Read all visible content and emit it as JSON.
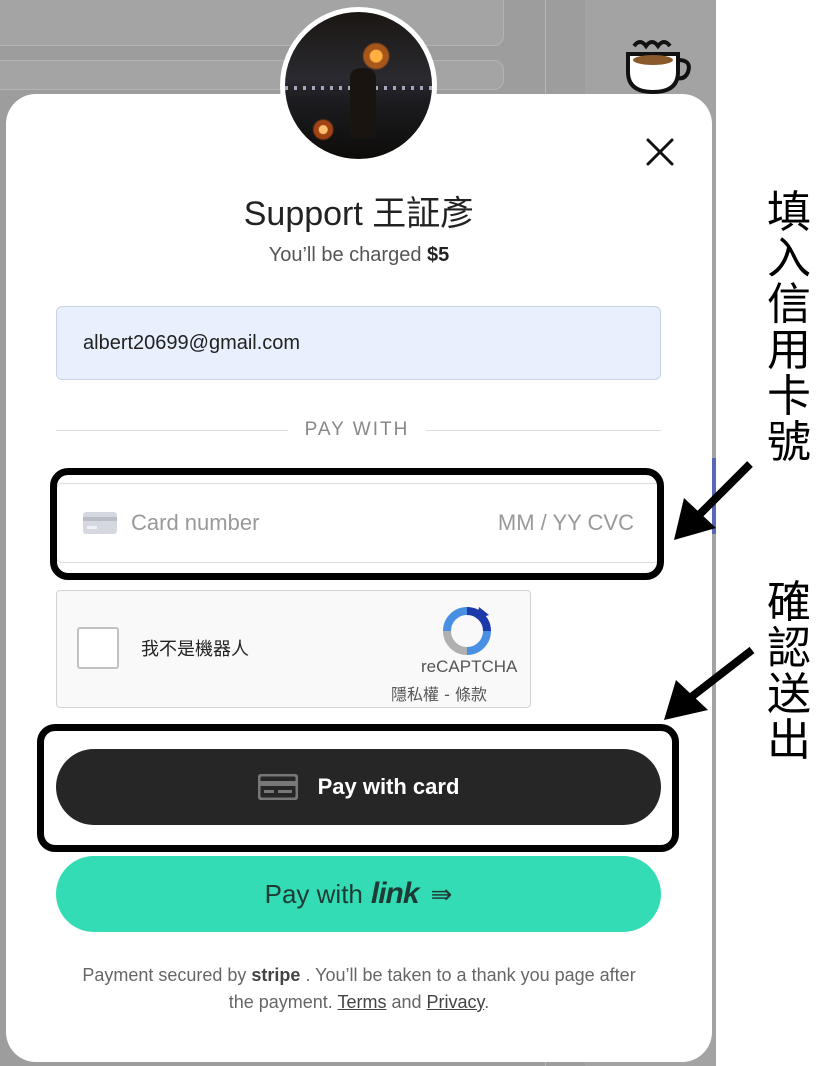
{
  "modal": {
    "title": "Support 王証彥",
    "charge_prefix": "You’ll be charged ",
    "charge_amount": "$5",
    "email": "albert20699@gmail.com",
    "pay_with_label": "PAY WITH",
    "card_placeholder": "Card number",
    "card_expiry_cvc": "MM / YY CVC",
    "captcha": {
      "label": "我不是機器人",
      "brand": "reCAPTCHA",
      "terms": "隱私權 - 條款"
    },
    "pay_card_label": "Pay with card",
    "pay_link_prefix": "Pay with",
    "pay_link_brand": "link",
    "pay_link_arrow": "⇛",
    "footer": {
      "part1": "Payment secured by ",
      "stripe": "stripe",
      "part2": " . You’ll be taken to a thank you page after the payment. ",
      "terms": "Terms",
      "and": " and ",
      "privacy": "Privacy",
      "end": "."
    }
  },
  "annotations": {
    "card_note": "填入信用卡號",
    "submit_note": "確認送出"
  },
  "colors": {
    "link_green": "#33dcb4",
    "dark_button": "#262626",
    "email_bg": "#e8f0fe"
  },
  "icons": [
    "close-icon",
    "card-icon",
    "recaptcha-icon",
    "coffee-cup-icon",
    "avatar-photo"
  ]
}
